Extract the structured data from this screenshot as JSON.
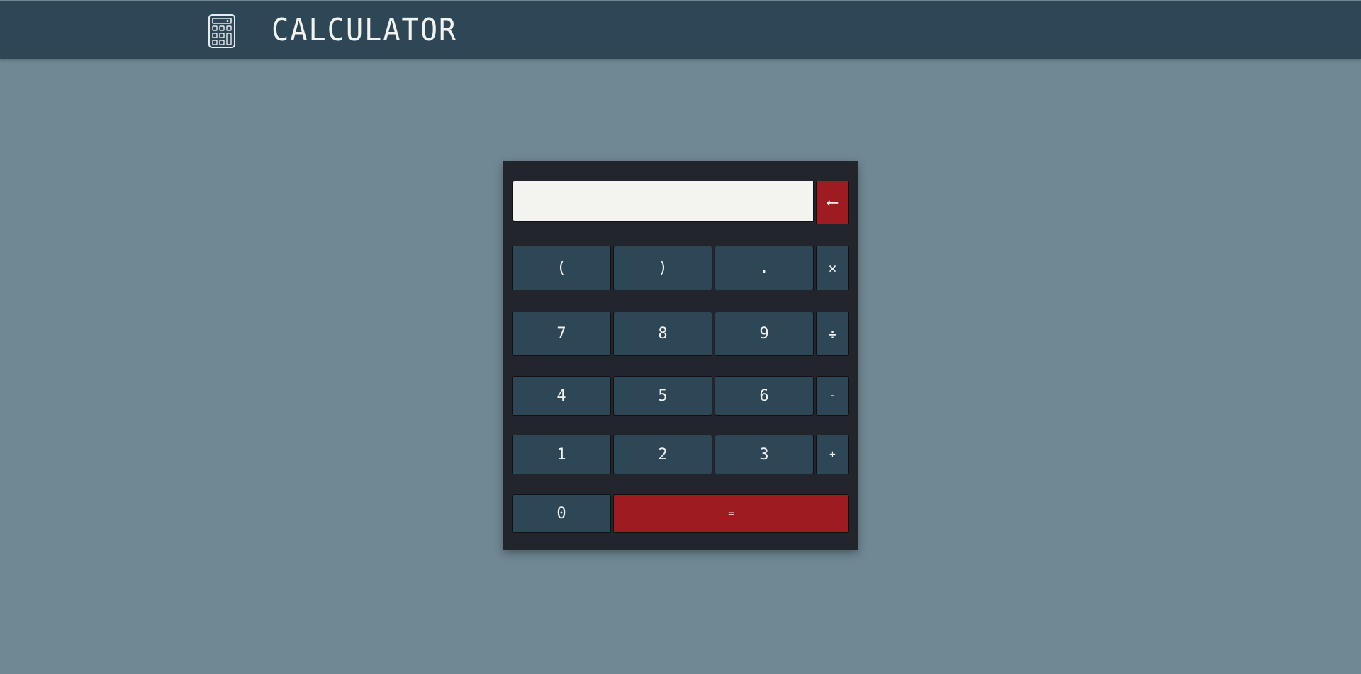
{
  "header": {
    "title": "CALCULATOR",
    "logo_icon": "calculator-icon"
  },
  "calculator": {
    "display": {
      "value": "",
      "placeholder": ""
    },
    "backspace_label": "⟵",
    "rows": [
      [
        "(",
        ")",
        ".",
        "×"
      ],
      [
        "7",
        "8",
        "9",
        "÷"
      ],
      [
        "4",
        "5",
        "6",
        "-"
      ],
      [
        "1",
        "2",
        "3",
        "+"
      ]
    ],
    "zero_label": "0",
    "equals_label": "="
  },
  "colors": {
    "background": "#6f8894",
    "header": "#2e4756",
    "panel": "#22252b",
    "key": "#2e4756",
    "accent_red": "#9e1b22",
    "display": "#f3f3ef"
  }
}
